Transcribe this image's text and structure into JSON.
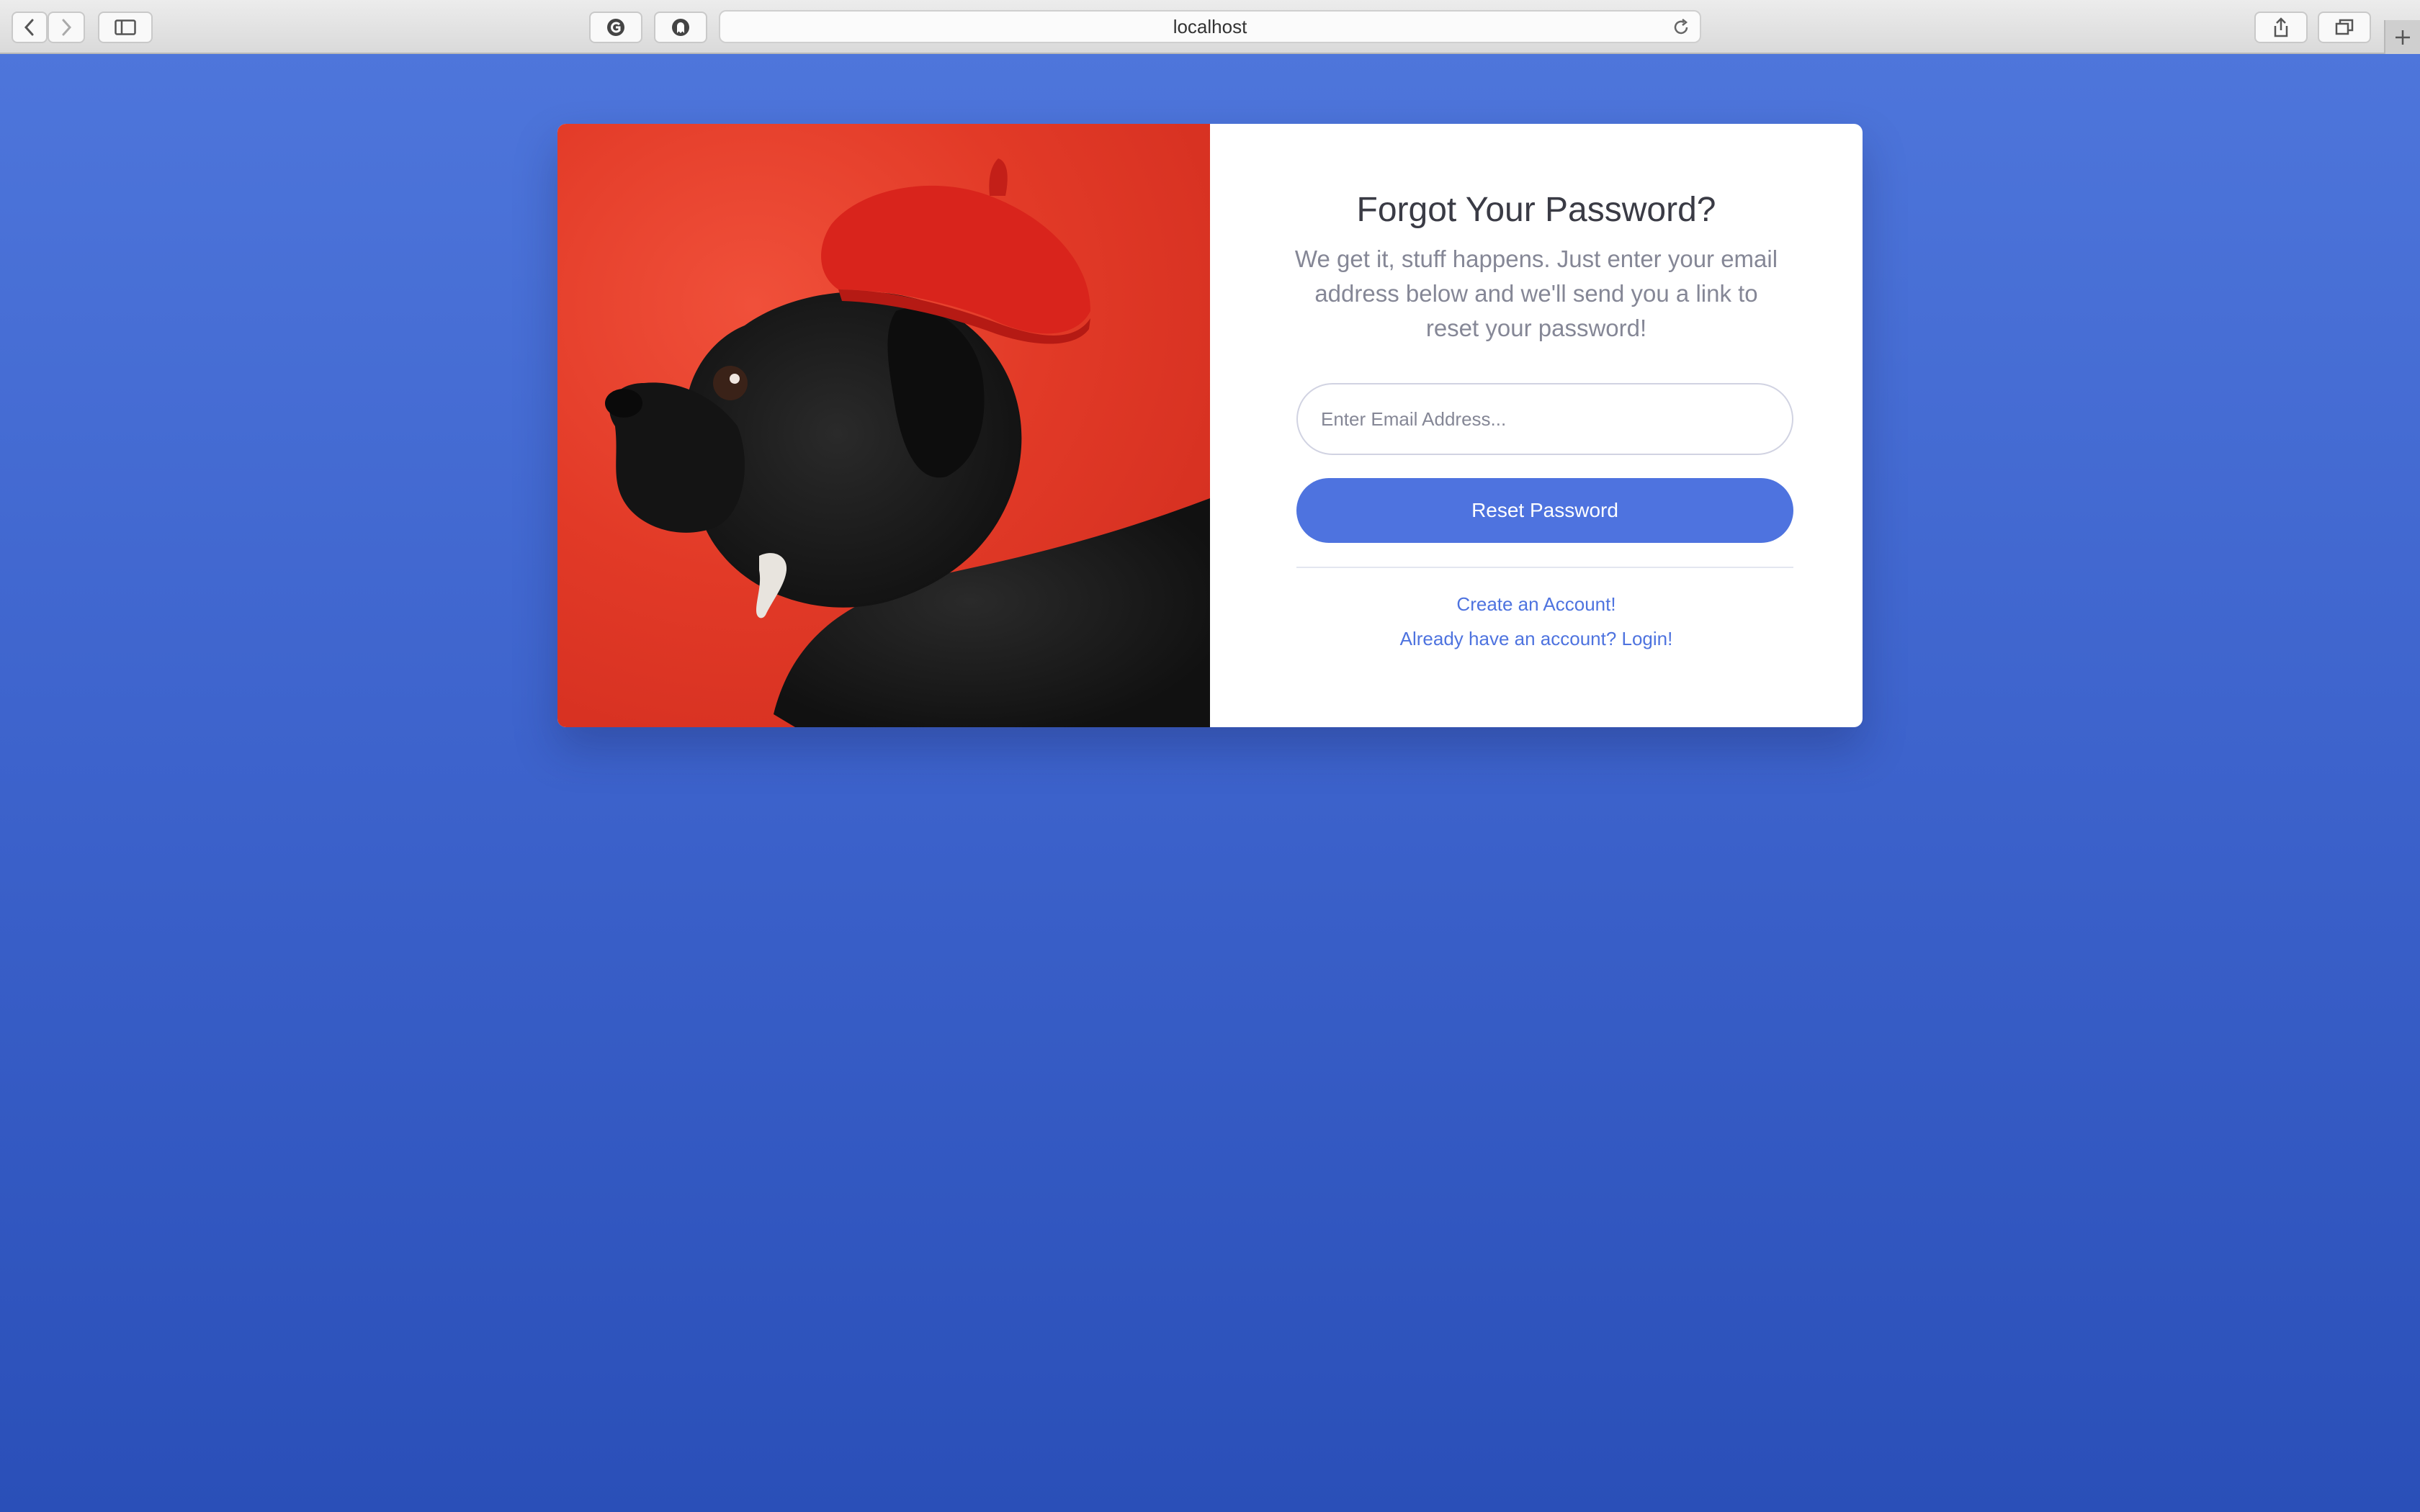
{
  "browser": {
    "url": "localhost",
    "icons": [
      "back-icon",
      "forward-icon",
      "sidebar-icon",
      "extension-g-icon",
      "extension-ghostery-icon",
      "reload-icon",
      "share-icon",
      "tabs-icon",
      "new-tab-icon"
    ]
  },
  "card": {
    "image_alt": "pug wearing a red beret",
    "title": "Forgot Your Password?",
    "subtitle": "We get it, stuff happens. Just enter your email address below and we'll send you a link to reset your password!",
    "email": {
      "placeholder": "Enter Email Address...",
      "value": ""
    },
    "reset_button": "Reset Password",
    "create_account_link": "Create an Account!",
    "login_link": "Already have an account? Login!"
  },
  "colors": {
    "primary": "#4e73df",
    "background_top": "#4f77dc",
    "background_bottom": "#2a4fb8",
    "photo_red": "#e23a27"
  }
}
